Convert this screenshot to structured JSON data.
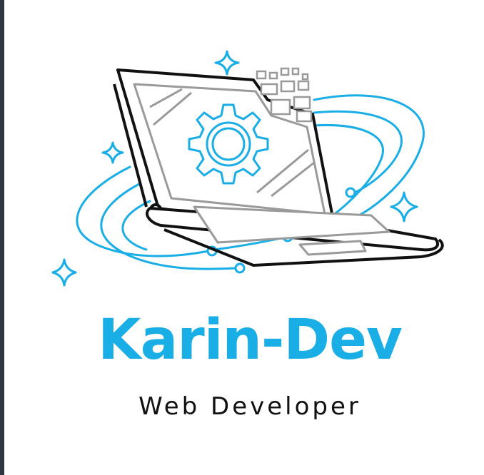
{
  "brand": {
    "name": "Karin-Dev",
    "tagline": "Web Developer"
  },
  "colors": {
    "accent": "#1aaee6",
    "outline": "#111111",
    "screen_gray": "#9a9a9a",
    "background": "#ffffff"
  },
  "icons": [
    "laptop-icon",
    "gear-icon",
    "sparkle-icon",
    "pixel-cluster-icon",
    "circuit-line-icon"
  ]
}
